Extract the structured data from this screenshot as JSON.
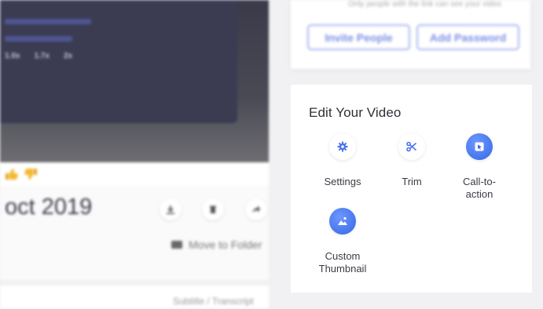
{
  "player": {
    "speeds": [
      "1.0x",
      "1.7x",
      "2x"
    ]
  },
  "video": {
    "title": "oct 2019",
    "move_to_folder": "Move to Folder",
    "bottom_label": "Subtitle / Transcript"
  },
  "share": {
    "note": "Only people with the link can see your video",
    "invite_label": "Invite People",
    "password_label": "Add Password"
  },
  "edit": {
    "title": "Edit Your Video",
    "tools": [
      {
        "label": "Settings",
        "icon": "gear-icon"
      },
      {
        "label": "Trim",
        "icon": "scissors-icon"
      },
      {
        "label": "Call-to-\naction",
        "icon": "cursor-click-icon"
      },
      {
        "label": "Custom\nThumbnail",
        "icon": "image-icon"
      }
    ]
  },
  "colors": {
    "accent": "#4a74ee",
    "accent_light": "#a9b6f2",
    "background": "#f1f1f3"
  }
}
